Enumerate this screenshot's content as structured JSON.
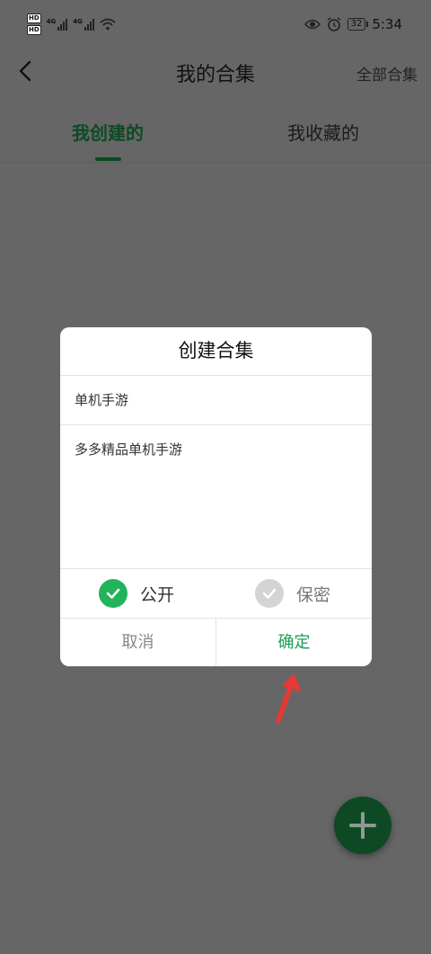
{
  "status_bar": {
    "hd1": "HD",
    "hd2": "HD",
    "net1": "4G",
    "net2": "4G",
    "battery": "32",
    "time": "5:34"
  },
  "header": {
    "title": "我的合集",
    "all_collections": "全部合集"
  },
  "tabs": [
    {
      "label": "我创建的",
      "active": true
    },
    {
      "label": "我收藏的",
      "active": false
    }
  ],
  "dialog": {
    "title": "创建合集",
    "name_value": "单机手游",
    "description_value": "多多精品单机手游",
    "visibility": {
      "public_label": "公开",
      "private_label": "保密",
      "selected": "公开"
    },
    "cancel_label": "取消",
    "confirm_label": "确定"
  },
  "colors": {
    "overlay": "#666666",
    "accent_dark_green": "#0d4a24",
    "accent_green": "#22b35b",
    "annotation_red": "#e53935"
  },
  "icons": {
    "back": "back-icon",
    "add": "plus-icon",
    "check": "check-icon",
    "eye": "eye-icon",
    "alarm": "alarm-icon",
    "wifi": "wifi-icon",
    "arrow_annotation": "red-arrow-icon"
  }
}
